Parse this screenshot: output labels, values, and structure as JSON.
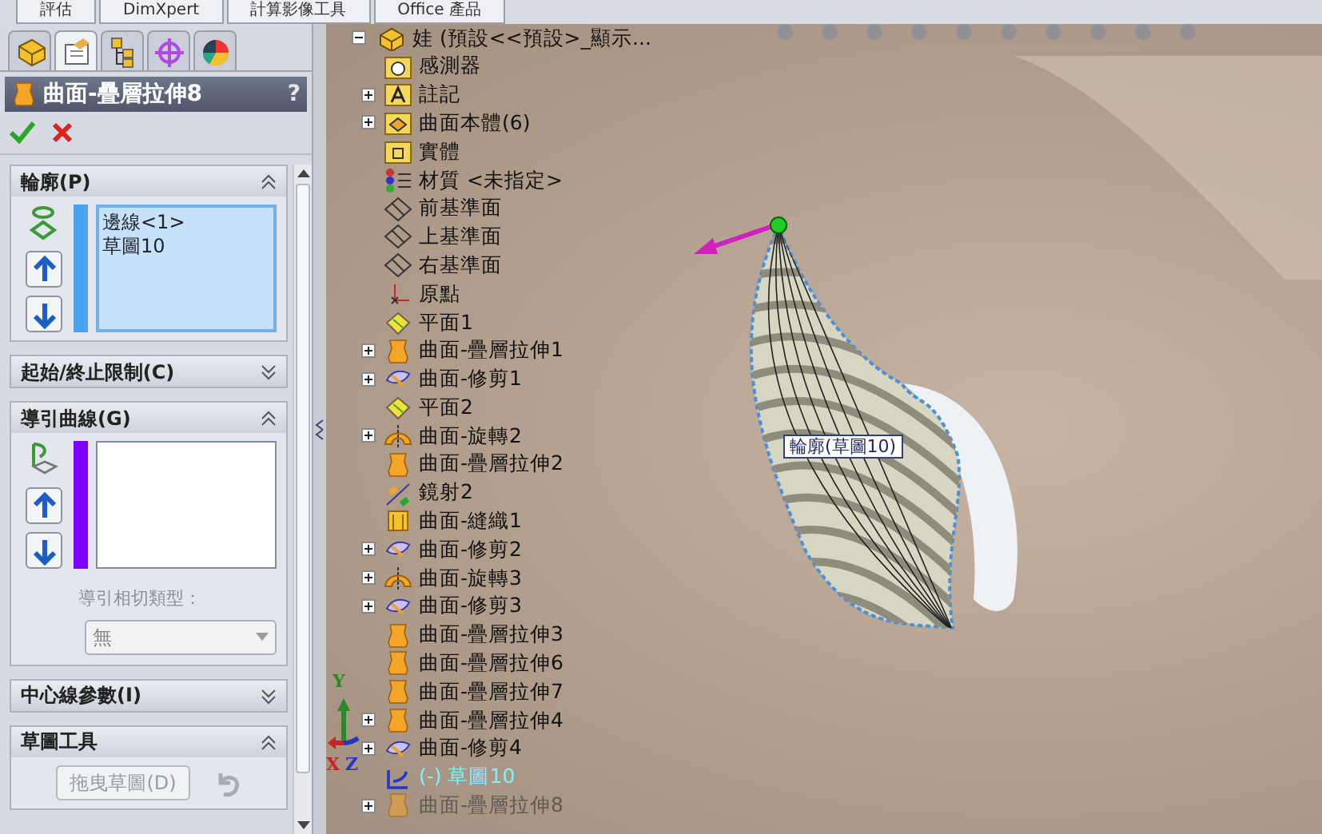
{
  "command_tabs": [
    {
      "label": "評估",
      "selected": false
    },
    {
      "label": "DimXpert",
      "selected": false
    },
    {
      "label": "計算影像工具",
      "selected": false
    },
    {
      "label": "Office 產品",
      "selected": false
    }
  ],
  "panel_tabs": [
    {
      "kind": "feature-tree",
      "selected": false
    },
    {
      "kind": "property",
      "selected": true
    },
    {
      "kind": "configuration",
      "selected": false
    },
    {
      "kind": "dimxpert",
      "selected": false
    },
    {
      "kind": "display",
      "selected": false
    }
  ],
  "property_manager": {
    "title": "曲面-疊層拉伸8",
    "help": "?",
    "sections": [
      {
        "kind": "profile",
        "title": "輪廓(P)",
        "expanded": true,
        "active": true,
        "color": "#4ba3f0",
        "items": [
          "邊線<1>",
          "草圖10"
        ]
      },
      {
        "kind": "plain",
        "title": "起始/終止限制(C)",
        "expanded": false
      },
      {
        "kind": "guide",
        "title": "導引曲線(G)",
        "expanded": true,
        "active": false,
        "color": "#8000ff",
        "tangency_label": "導引相切類型：",
        "tangency_value": "無",
        "disabled": true
      },
      {
        "kind": "plain",
        "title": "中心線參數(I)",
        "expanded": false
      },
      {
        "kind": "tools",
        "title": "草圖工具",
        "expanded": true,
        "button": "拖曳草圖(D)",
        "disabled": true
      }
    ]
  },
  "tree": [
    {
      "label": "娃  (預設<<預設>_顯示...",
      "kind": "part",
      "expanded": true,
      "selected": false,
      "disabled": false
    },
    {
      "label": "感測器",
      "kind": "folder-sensor",
      "selected": false,
      "disabled": false
    },
    {
      "label": "註記",
      "kind": "folder-annotation",
      "expanded": false,
      "selected": false,
      "disabled": false
    },
    {
      "label": "曲面本體(6)",
      "kind": "folder-surface",
      "expanded": false,
      "selected": false,
      "disabled": false
    },
    {
      "label": "實體",
      "kind": "folder-solid",
      "selected": false,
      "disabled": false
    },
    {
      "label": "材質 <未指定>",
      "kind": "material",
      "selected": false,
      "disabled": false
    },
    {
      "label": "前基準面",
      "kind": "plane",
      "selected": false,
      "disabled": false
    },
    {
      "label": "上基準面",
      "kind": "plane",
      "selected": false,
      "disabled": false
    },
    {
      "label": "右基準面",
      "kind": "plane",
      "selected": false,
      "disabled": false
    },
    {
      "label": "原點",
      "kind": "origin",
      "selected": false,
      "disabled": false
    },
    {
      "label": "平面1",
      "kind": "ref-plane",
      "selected": false,
      "disabled": false
    },
    {
      "label": "曲面-疊層拉伸1",
      "kind": "loft",
      "expanded": false,
      "selected": false,
      "disabled": false
    },
    {
      "label": "曲面-修剪1",
      "kind": "trim",
      "expanded": false,
      "selected": false,
      "disabled": false
    },
    {
      "label": "平面2",
      "kind": "ref-plane",
      "selected": false,
      "disabled": false
    },
    {
      "label": "曲面-旋轉2",
      "kind": "revolve",
      "expanded": false,
      "selected": false,
      "disabled": false
    },
    {
      "label": "曲面-疊層拉伸2",
      "kind": "loft",
      "selected": false,
      "disabled": false
    },
    {
      "label": "鏡射2",
      "kind": "mirror",
      "selected": false,
      "disabled": false
    },
    {
      "label": "曲面-縫織1",
      "kind": "knit",
      "selected": false,
      "disabled": false
    },
    {
      "label": "曲面-修剪2",
      "kind": "trim",
      "expanded": false,
      "selected": false,
      "disabled": false
    },
    {
      "label": "曲面-旋轉3",
      "kind": "revolve",
      "expanded": false,
      "selected": false,
      "disabled": false
    },
    {
      "label": "曲面-修剪3",
      "kind": "trim",
      "expanded": false,
      "selected": false,
      "disabled": false
    },
    {
      "label": "曲面-疊層拉伸3",
      "kind": "loft",
      "selected": false,
      "disabled": false
    },
    {
      "label": "曲面-疊層拉伸6",
      "kind": "loft",
      "selected": false,
      "disabled": false
    },
    {
      "label": "曲面-疊層拉伸7",
      "kind": "loft",
      "selected": false,
      "disabled": false
    },
    {
      "label": "曲面-疊層拉伸4",
      "kind": "loft",
      "expanded": false,
      "selected": false,
      "disabled": false
    },
    {
      "label": "曲面-修剪4",
      "kind": "trim",
      "expanded": false,
      "selected": false,
      "disabled": false
    },
    {
      "label": "(-) 草圖10",
      "kind": "sketch",
      "selected": true,
      "disabled": false
    },
    {
      "label": "曲面-疊層拉伸8",
      "kind": "loft",
      "expanded": false,
      "selected": false,
      "disabled": true
    }
  ],
  "viewport": {
    "callout": "輪廓(草圖10)",
    "triad": [
      "X",
      "Y",
      "Z"
    ]
  }
}
